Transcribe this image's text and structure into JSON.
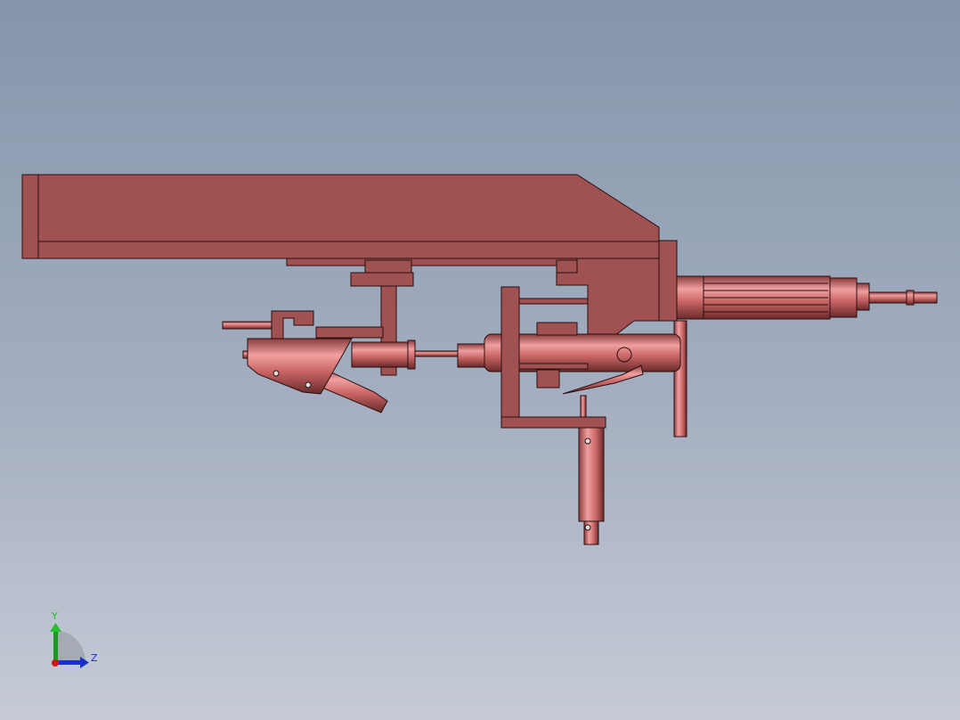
{
  "viewport": {
    "model_color": "#a05252",
    "background_top": "#8695ab",
    "background_bottom": "#c6cbd6"
  },
  "triad": {
    "y_label": "Y",
    "z_label": "Z",
    "y_color": "#22c02a",
    "z_color": "#1a2fd0",
    "x_color": "#d01818"
  }
}
